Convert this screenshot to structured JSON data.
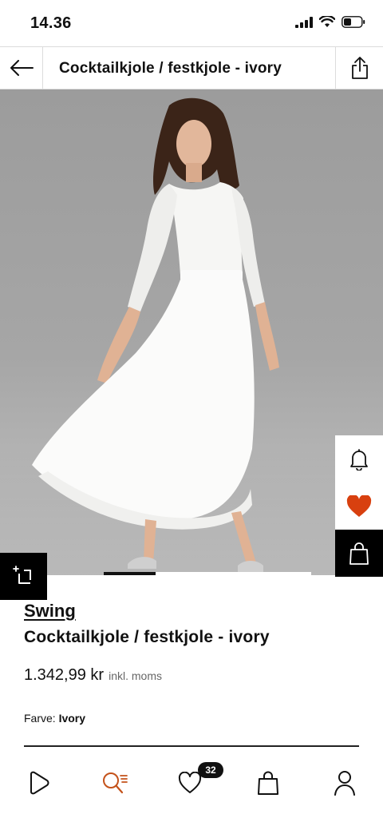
{
  "status_bar": {
    "time": "14.36"
  },
  "nav": {
    "title": "Cocktailkjole / festkjole - ivory"
  },
  "product": {
    "brand": "Swing",
    "name": "Cocktailkjole / festkjole - ivory",
    "price": "1.342,99 kr",
    "price_note": "inkl. moms",
    "color_label": "Farve:",
    "color_value": "Ivory",
    "image_alt": "product-photo-white-lace-dress",
    "image_progress": 0.25
  },
  "colors": {
    "favorite_accent": "#d8400f",
    "search_accent": "#c4521a",
    "dark": "#000000"
  },
  "tab_bar": {
    "items": [
      {
        "icon": "play-logo-icon"
      },
      {
        "icon": "search-icon",
        "active": true
      },
      {
        "icon": "heart-icon"
      },
      {
        "icon": "bag-icon"
      },
      {
        "icon": "user-icon"
      }
    ],
    "wishlist_count": "32"
  }
}
